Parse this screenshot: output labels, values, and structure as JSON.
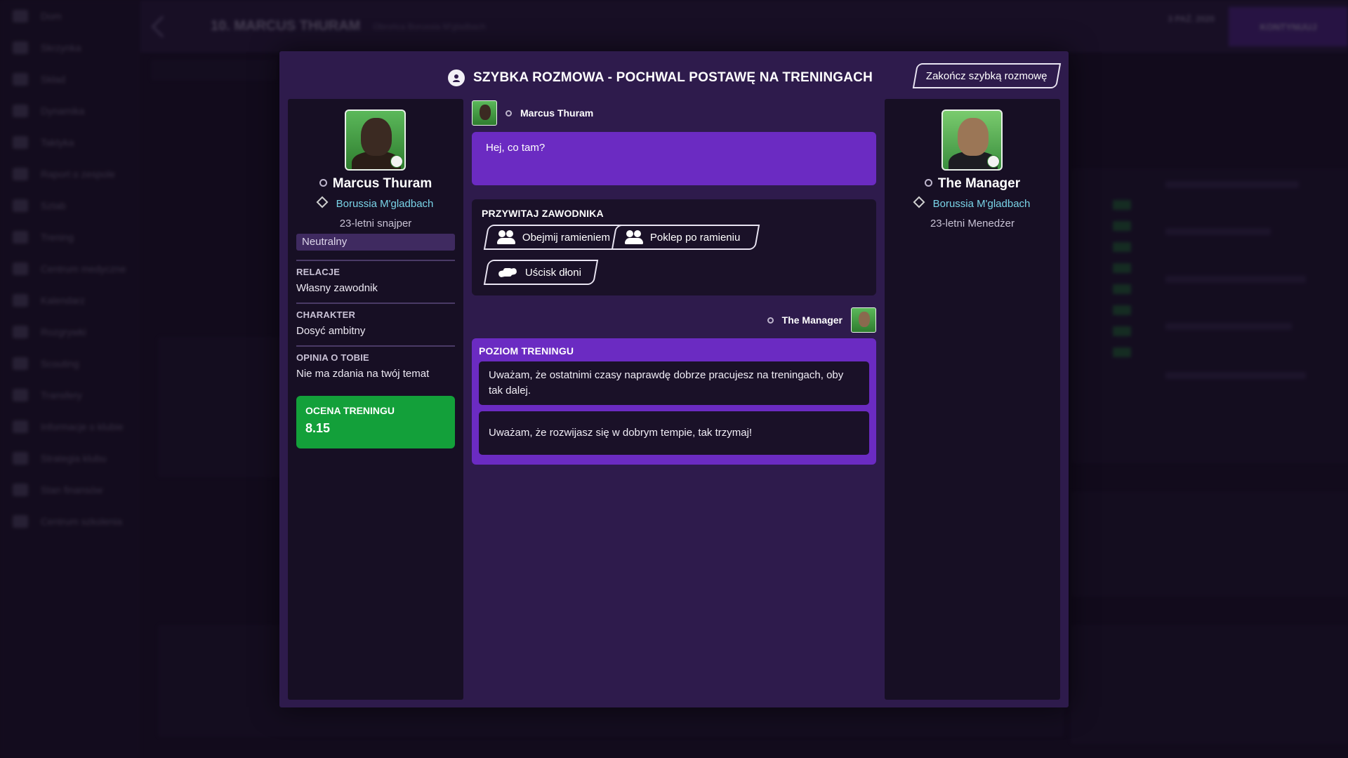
{
  "modal": {
    "title": "SZYBKA ROZMOWA - POCHWAL POSTAWĘ NA TRENINGACH",
    "end_button": "Zakończ szybką rozmowę"
  },
  "player": {
    "name": "Marcus Thuram",
    "club": "Borussia M'gladbach",
    "role": "23-letni snajper",
    "mood": "Neutralny",
    "relations_label": "RELACJE",
    "relations_value": "Własny zawodnik",
    "character_label": "CHARAKTER",
    "character_value": "Dosyć ambitny",
    "opinion_label": "OPINIA O TOBIE",
    "opinion_value": "Nie ma zdania na twój temat",
    "rating_label": "OCENA TRENINGU",
    "rating_value": "8.15"
  },
  "manager": {
    "name": "The  Manager",
    "chat_name": "The Manager",
    "club": "Borussia M'gladbach",
    "role": "23-letni Menedżer"
  },
  "chat": {
    "player_message": "Hej, co tam?",
    "greet_heading": "PRZYWITAJ ZAWODNIKA",
    "greet_options": [
      "Obejmij ramieniem",
      "Poklep po ramieniu",
      "Uścisk dłoni"
    ],
    "response_heading": "POZIOM TRENINGU",
    "response_options": [
      "Uważam, że ostatnimi czasy naprawdę dobrze pracujesz na treningach, oby tak dalej.",
      "Uważam, że rozwijasz się w dobrym tempie, tak trzymaj!"
    ]
  },
  "background": {
    "page_title": "10. MARCUS THURAM",
    "subtitle": "Obrońca Borussia M'gladbach",
    "date": "3 PAŹ. 2020",
    "continue": "KONTYNUUJ",
    "nav": [
      "Dom",
      "Skrzynka",
      "Skład",
      "Dynamika",
      "Taktyka",
      "Raport o zespole",
      "Sztab",
      "Trening",
      "Centrum medyczne",
      "Kalendarz",
      "Rozgrywki",
      "Scouting",
      "Transfery",
      "Informacje o klubie",
      "Strategia klubu",
      "Stan finansów",
      "Centrum szkolenia"
    ]
  },
  "colors": {
    "modal_bg": "#2e1b4c",
    "card_bg": "#170f24",
    "accent_purple": "#6b2bc2",
    "rating_green": "#13a03a",
    "club_cyan": "#7ad4e8"
  }
}
